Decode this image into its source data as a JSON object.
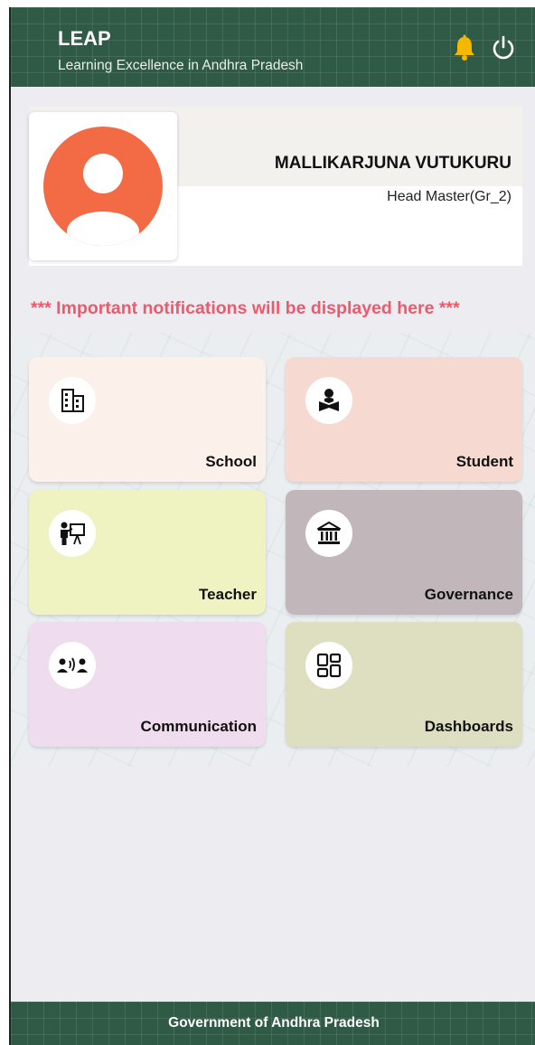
{
  "header": {
    "title": "LEAP",
    "subtitle": "Learning Excellence in Andhra Pradesh",
    "notification_icon": "bell-icon",
    "logout_icon": "power-icon",
    "bell_color": "#f5b800",
    "bar_color": "#2f5a45"
  },
  "profile": {
    "name": "MALLIKARJUNA VUTUKURU",
    "role": "Head Master(Gr_2)",
    "avatar_icon": "user-avatar-icon",
    "avatar_color": "#f26b45"
  },
  "notice": "*** Important notifications will be displayed here ***",
  "tiles": [
    {
      "label": "School",
      "icon": "school-building-icon",
      "color": "#fbf0ea"
    },
    {
      "label": "Student",
      "icon": "student-reading-icon",
      "color": "#f6d9d1"
    },
    {
      "label": "Teacher",
      "icon": "teacher-board-icon",
      "color": "#eff3c1"
    },
    {
      "label": "Governance",
      "icon": "government-building-icon",
      "color": "#c1b7bb"
    },
    {
      "label": "Communication",
      "icon": "people-talking-icon",
      "color": "#efdcee"
    },
    {
      "label": "Dashboards",
      "icon": "dashboard-grid-icon",
      "color": "#dedec0"
    }
  ],
  "footer": "Government of Andhra Pradesh"
}
